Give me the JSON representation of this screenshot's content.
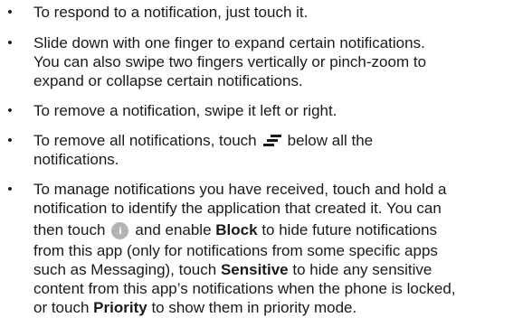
{
  "bullets": [
    {
      "lines": [
        "To respond to a notification, just touch it."
      ]
    },
    {
      "lines": [
        "Slide down with one finger to expand certain notifications.",
        "You can also swipe two fingers vertically or pinch-zoom to",
        "expand or collapse certain notifications."
      ]
    },
    {
      "lines": [
        "To remove a notification, swipe it left or right."
      ]
    },
    {
      "line1_before_icon": "To remove all notifications, touch",
      "line1_after_icon": "below all the",
      "icon": "clear-all-icon",
      "line2": "notifications."
    },
    {
      "line1": "To manage notifications you have received, touch and hold a",
      "line2": "notification to identify the application that created it. You can",
      "line3_before_icon": "then touch",
      "info_icon_glyph": "i",
      "icon": "info-icon",
      "line3_mid": "and enable",
      "block_label": "Block",
      "line3_after": "to hide future notifications",
      "line4": "from this app (only for notifications from some specific apps",
      "line5": "such as Messaging), touch",
      "sensitive_label": "Sensitive",
      "line5_after": "to hide any sensitive",
      "line6": "content from this app’s notifications when the phone is locked,",
      "line7_before": "or touch",
      "priority_label": "Priority",
      "line7_after": "to show them in priority mode."
    }
  ],
  "bullet_glyph": "•",
  "colors": {
    "text": "#1a1a1a",
    "icon_gray": "#b3b3b3",
    "clear_all_icon": "#1a1a1a"
  }
}
